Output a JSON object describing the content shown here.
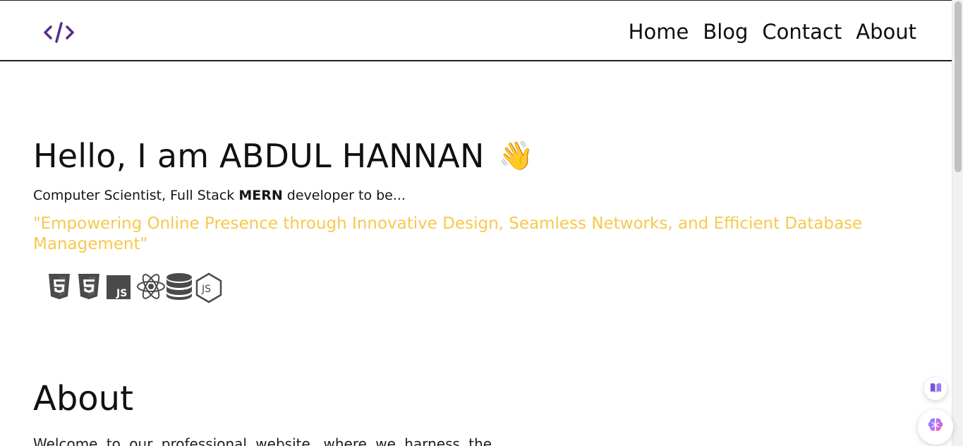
{
  "nav": {
    "logo_icon": "code-slash-icon",
    "logo_color": "#5b2a8c",
    "links": [
      "Home",
      "Blog",
      "Contact",
      "About"
    ]
  },
  "hero": {
    "title": "Hello, I am ABDUL HANNAN",
    "emoji": "👋",
    "subtitle_prefix": "Computer Scientist, Full Stack ",
    "subtitle_bold": "MERN",
    "subtitle_suffix": " developer to be...",
    "tagline": "\"Empowering Online Presence through Innovative Design, Seamless Networks, and Efficient Database Management\"",
    "tagline_color": "#f7c84d",
    "stack_icons": [
      "html5-icon",
      "css3-icon",
      "javascript-icon",
      "react-icon",
      "database-icon",
      "nodejs-icon"
    ]
  },
  "about": {
    "title": "About",
    "text": "Welcome to our professional website, where we harness the"
  },
  "floating": {
    "reader_icon": "book-icon",
    "assistant_icon": "brain-icon"
  }
}
